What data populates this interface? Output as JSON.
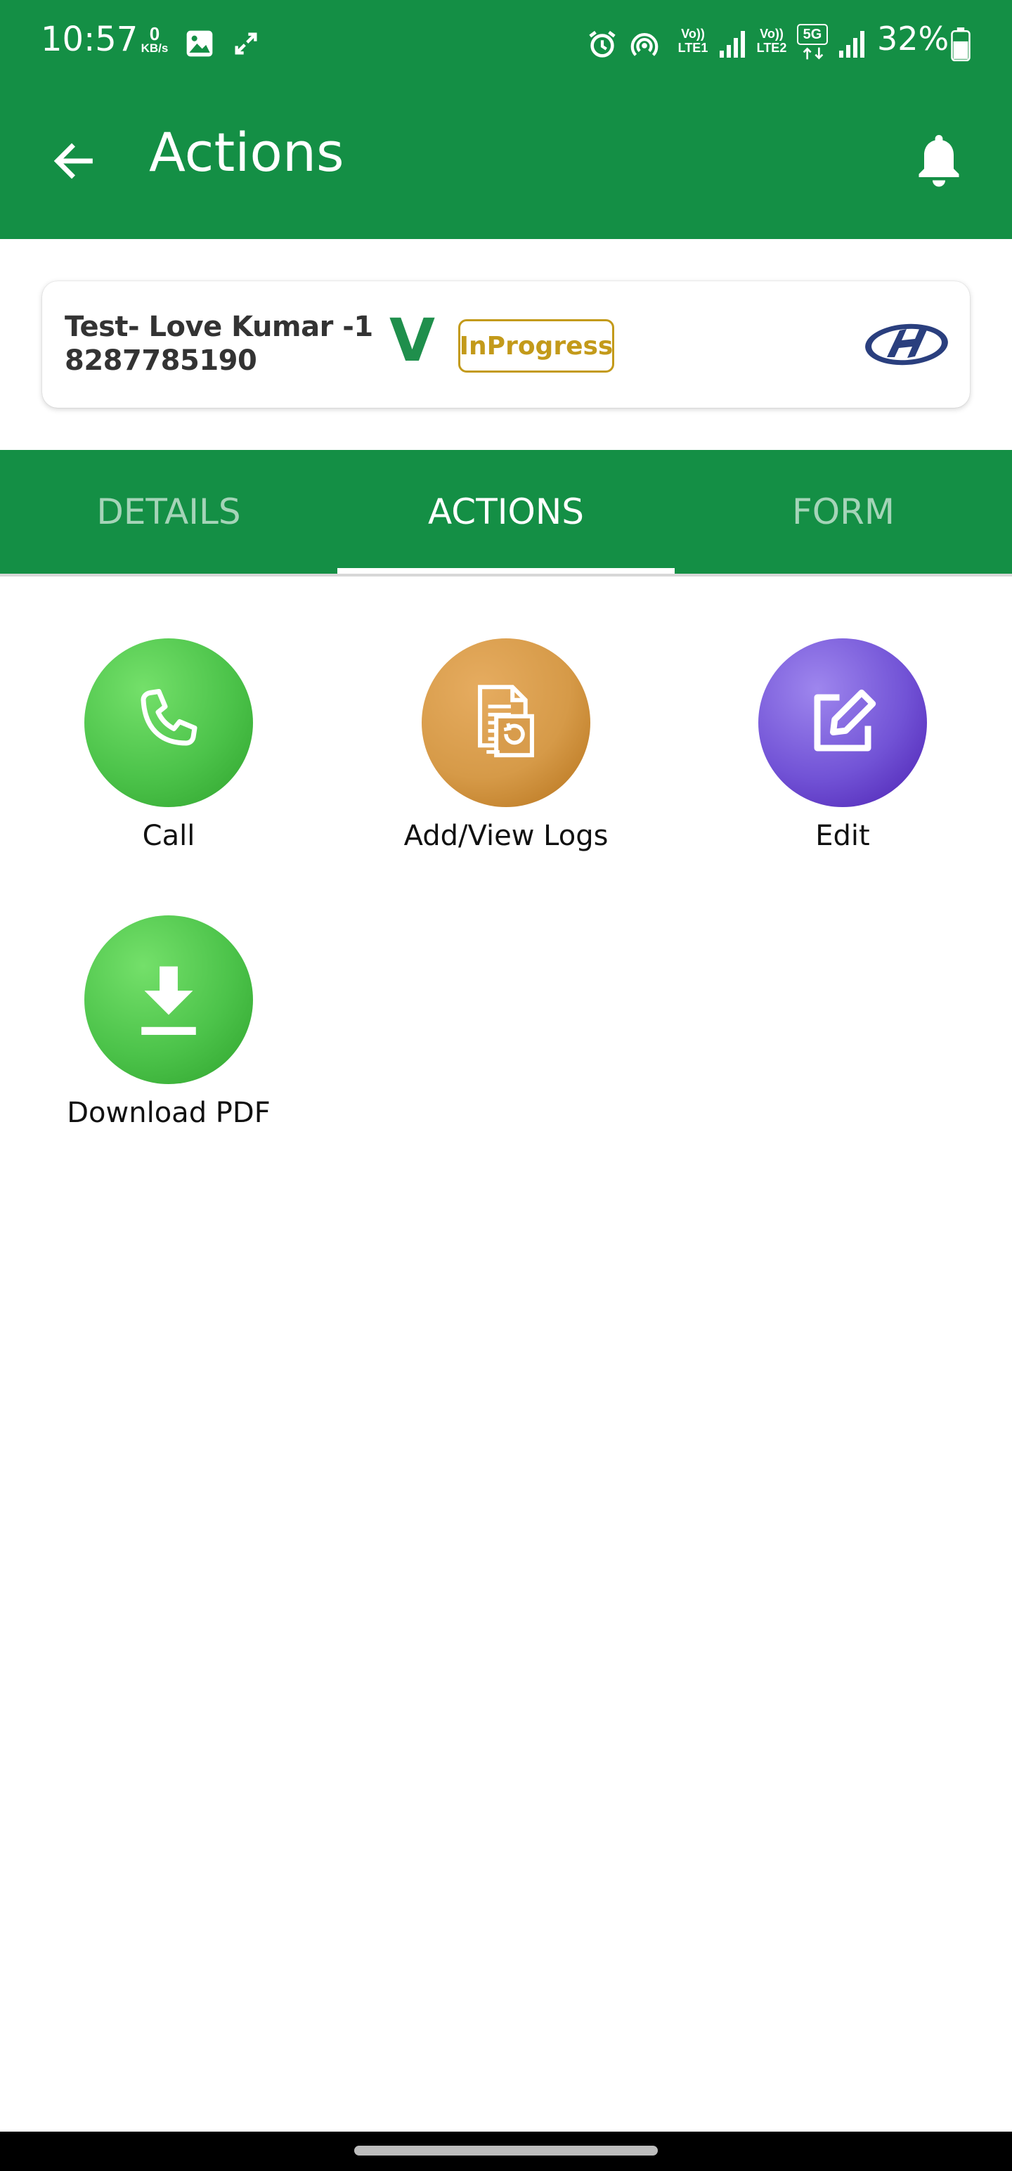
{
  "status_bar": {
    "time": "10:57",
    "net_speed_value": "0",
    "net_speed_unit": "KB/s",
    "battery": "32%",
    "lte1": "LTE1",
    "lte2": "LTE2",
    "volte": "Vo))",
    "network_5g": "5G",
    "icons": [
      "gallery-icon",
      "expand-icon",
      "alarm-icon",
      "hotspot-icon",
      "signal-icon",
      "battery-icon"
    ]
  },
  "appbar": {
    "title": "Actions",
    "back_icon": "arrow-left-icon",
    "bell_icon": "bell-icon"
  },
  "lead": {
    "name": "Test- Love Kumar -1",
    "phone": "8287785190",
    "v_mark": "V",
    "status": "InProgress",
    "brand_logo": "hyundai-logo"
  },
  "tabs": [
    {
      "label": "DETAILS",
      "active": false
    },
    {
      "label": "ACTIONS",
      "active": true
    },
    {
      "label": "FORM",
      "active": false
    }
  ],
  "actions": [
    {
      "label": "Call",
      "icon": "phone-icon",
      "color": "#4cc34a"
    },
    {
      "label": "Add/View Logs",
      "icon": "logs-icon",
      "color": "#d69a48"
    },
    {
      "label": "Edit",
      "icon": "edit-icon",
      "color": "#7253d6"
    },
    {
      "label": "Download PDF",
      "icon": "download-icon",
      "color": "#4cc34a"
    }
  ],
  "colors": {
    "primary": "#148f45",
    "status_badge": "#c39a1a",
    "v_mark": "#1f8f4c"
  }
}
